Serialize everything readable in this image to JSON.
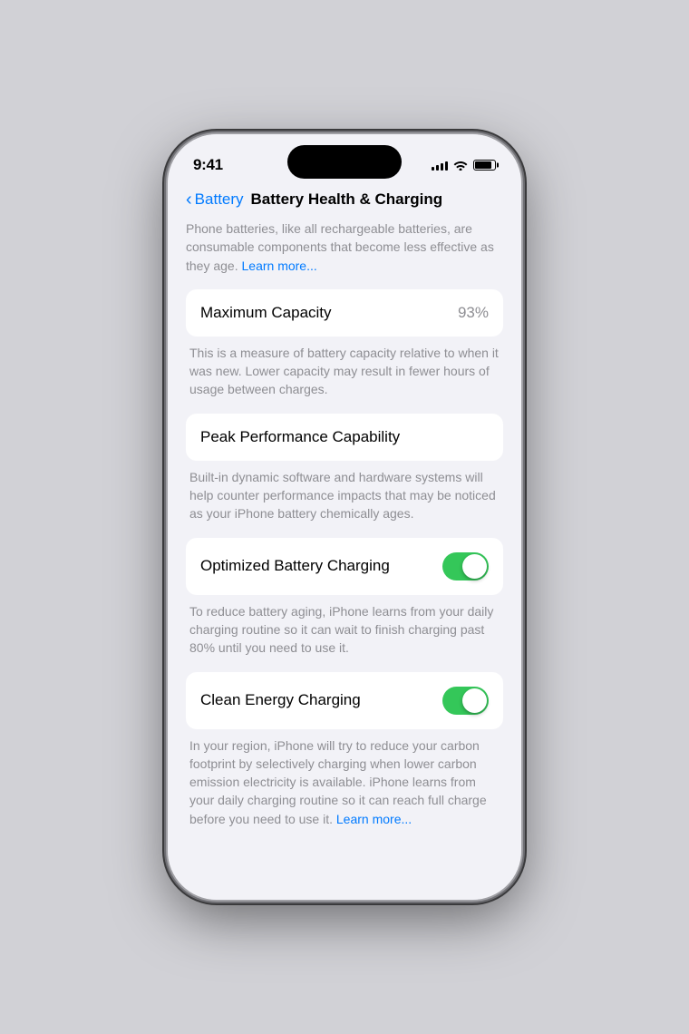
{
  "statusBar": {
    "time": "9:41",
    "signalBars": [
      4,
      6,
      8,
      10,
      12
    ],
    "batteryPercent": 85
  },
  "navigation": {
    "backLabel": "Battery",
    "pageTitle": "Battery Health & Charging"
  },
  "intro": {
    "description": "Phone batteries, like all rechargeable batteries, are consumable components that become less effective as they age.",
    "learnMoreLabel": "Learn more..."
  },
  "maximumCapacity": {
    "label": "Maximum Capacity",
    "value": "93%",
    "note": "This is a measure of battery capacity relative to when it was new. Lower capacity may result in fewer hours of usage between charges."
  },
  "peakPerformance": {
    "label": "Peak Performance Capability",
    "note": "Built-in dynamic software and hardware systems will help counter performance impacts that may be noticed as your iPhone battery chemically ages."
  },
  "optimizedCharging": {
    "label": "Optimized Battery Charging",
    "enabled": true,
    "note": "To reduce battery aging, iPhone learns from your daily charging routine so it can wait to finish charging past 80% until you need to use it."
  },
  "cleanEnergy": {
    "label": "Clean Energy Charging",
    "enabled": true,
    "note": "In your region, iPhone will try to reduce your carbon footprint by selectively charging when lower carbon emission electricity is available. iPhone learns from your daily charging routine so it can reach full charge before you need to use it.",
    "learnMoreLabel": "Learn more..."
  }
}
